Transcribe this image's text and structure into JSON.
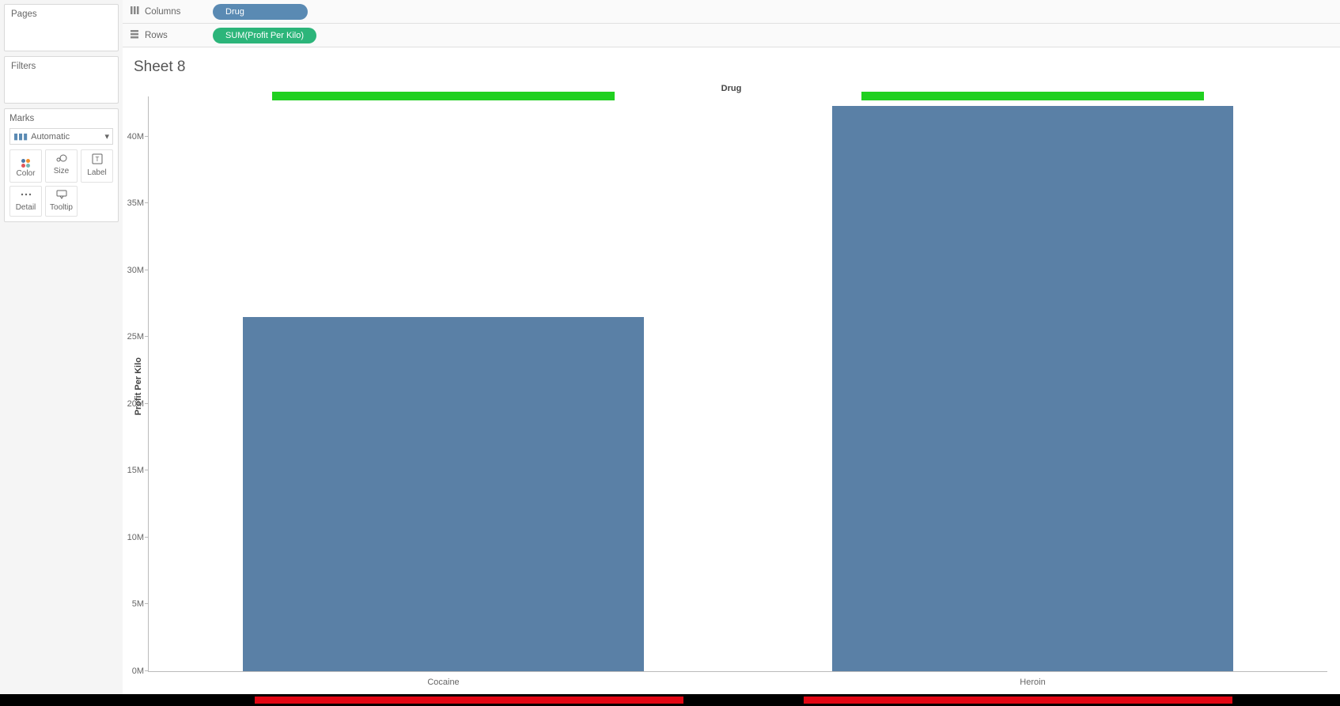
{
  "panels": {
    "pages": "Pages",
    "filters": "Filters",
    "marks": "Marks",
    "marks_type": "Automatic",
    "marks_items": {
      "color": "Color",
      "size": "Size",
      "label": "Label",
      "detail": "Detail",
      "tooltip": "Tooltip"
    }
  },
  "shelves": {
    "columns_label": "Columns",
    "rows_label": "Rows",
    "columns_pill": "Drug",
    "rows_pill": "SUM(Profit Per Kilo)"
  },
  "viz": {
    "sheet_title": "Sheet 8",
    "x_axis_title": "Drug",
    "y_axis_title": "Profit Per Kilo",
    "y_ticks": [
      "0M",
      "5M",
      "10M",
      "15M",
      "20M",
      "25M",
      "30M",
      "35M",
      "40M"
    ],
    "categories": [
      "Cocaine",
      "Heroin"
    ]
  },
  "chart_data": {
    "type": "bar",
    "title": "Sheet 8",
    "xlabel": "Drug",
    "ylabel": "Profit Per Kilo",
    "categories": [
      "Cocaine",
      "Heroin"
    ],
    "values": [
      26500000,
      42300000
    ],
    "reference_band_top": 42700000,
    "ylim": [
      0,
      43000000
    ],
    "y_ticks": [
      0,
      5000000,
      10000000,
      15000000,
      20000000,
      25000000,
      30000000,
      35000000,
      40000000
    ]
  }
}
